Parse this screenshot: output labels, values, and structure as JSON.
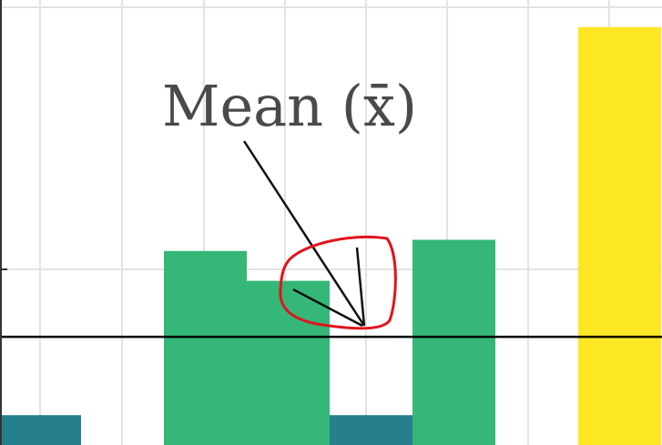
{
  "chart_data": {
    "type": "bar",
    "title": "",
    "xlabel": "",
    "ylabel": "",
    "bars": [
      {
        "value": 0.4,
        "color": "#267f8c"
      },
      {
        "value": 0.0,
        "color": "#267f8c"
      },
      {
        "value": 2.6,
        "color": "#35b778"
      },
      {
        "value": 2.2,
        "color": "#35b778"
      },
      {
        "value": 0.4,
        "color": "#267f8c"
      },
      {
        "value": 2.75,
        "color": "#35b778"
      },
      {
        "value": 0.0,
        "color": "#267f8c"
      },
      {
        "value": 5.6,
        "color": "#fde725"
      }
    ],
    "mean": 1.45,
    "ylim": [
      0,
      5.8
    ],
    "grid": true,
    "annotation": {
      "text": "Mean (x̄)",
      "color": "#4a4a4a"
    },
    "highlight": {
      "shape": "hand-drawn circle",
      "color": "#e0141c"
    }
  }
}
